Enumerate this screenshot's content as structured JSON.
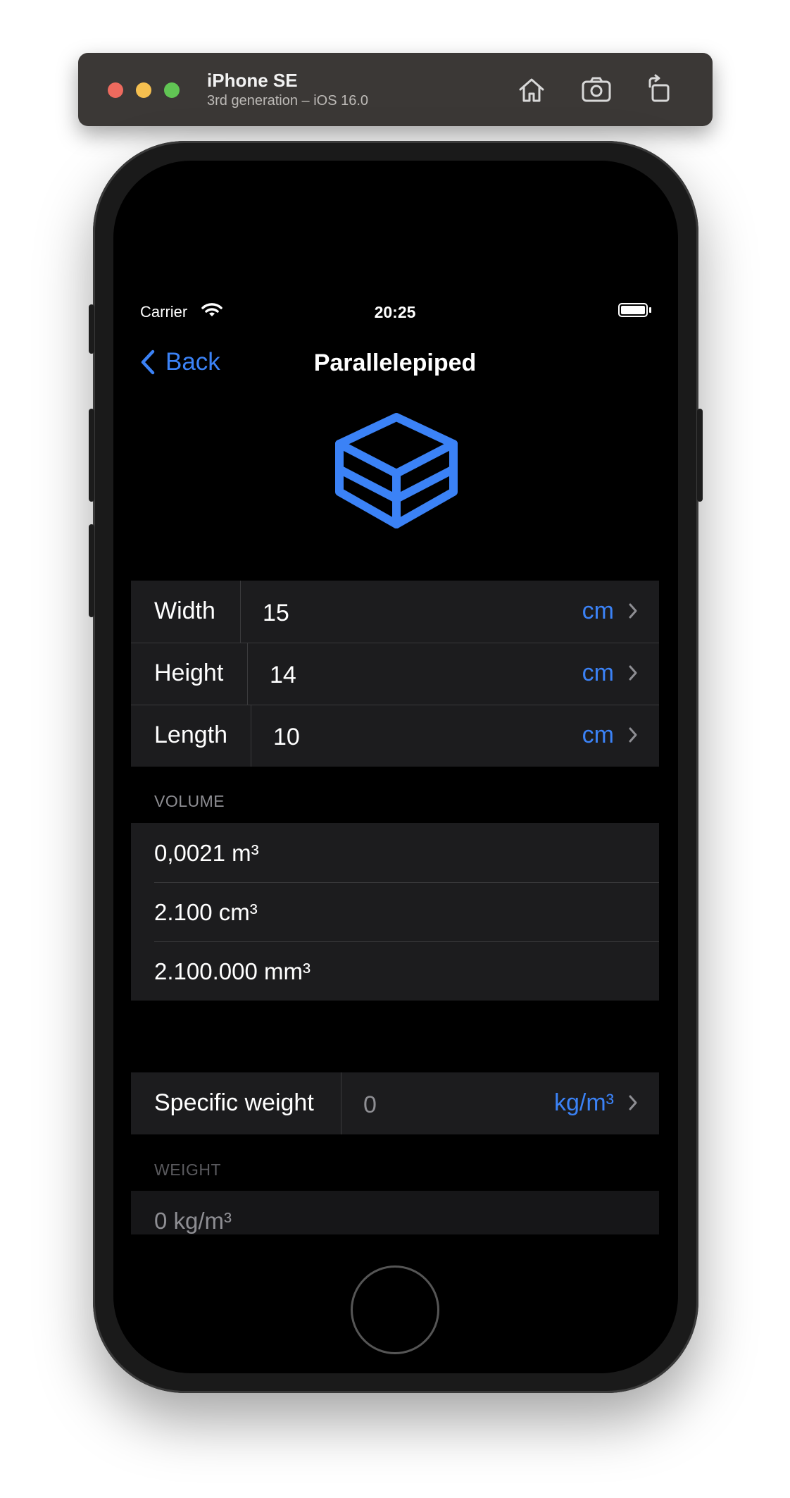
{
  "simulator": {
    "device_name": "iPhone SE",
    "device_subtitle": "3rd generation – iOS 16.0",
    "icons": [
      "home-icon",
      "screenshot-icon",
      "rotate-icon"
    ]
  },
  "status_bar": {
    "carrier": "Carrier",
    "time": "20:25"
  },
  "nav": {
    "back_label": "Back",
    "title": "Parallelepiped"
  },
  "dimensions": [
    {
      "label": "Width",
      "value": "15",
      "unit": "cm"
    },
    {
      "label": "Height",
      "value": "14",
      "unit": "cm"
    },
    {
      "label": "Length",
      "value": "10",
      "unit": "cm"
    }
  ],
  "volume": {
    "header": "VOLUME",
    "values": [
      "0,0021 m³",
      "2.100 cm³",
      "2.100.000 mm³"
    ]
  },
  "specific_weight": {
    "label": "Specific weight",
    "value": "0",
    "unit": "kg/m³"
  },
  "weight": {
    "header": "WEIGHT",
    "value": "0 kg/m³"
  },
  "colors": {
    "accent": "#3b82f6",
    "background": "#000000",
    "cell": "#1c1c1e"
  }
}
